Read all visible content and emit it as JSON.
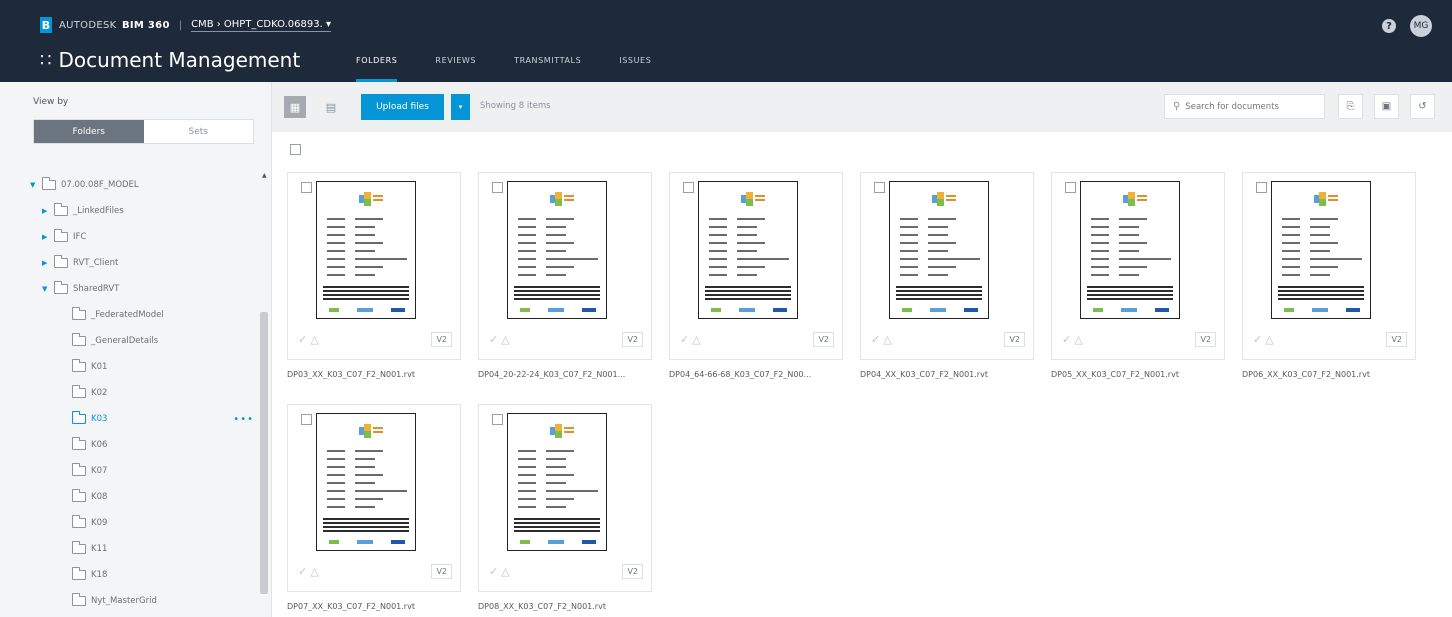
{
  "header": {
    "brand_logo": "B",
    "brand_prefix": "AUTODESK",
    "brand_product": "BIM 360",
    "separator": "|",
    "project": "CMB › OHPT_CDKO.06893. ▾",
    "title": "Document Management",
    "help_label": "?",
    "avatar_initials": "MG",
    "tabs": [
      {
        "label": "FOLDERS",
        "active": true
      },
      {
        "label": "REVIEWS",
        "active": false
      },
      {
        "label": "TRANSMITTALS",
        "active": false
      },
      {
        "label": "ISSUES",
        "active": false
      }
    ]
  },
  "sidebar": {
    "view_by_label": "View by",
    "toggle": {
      "folders": "Folders",
      "sets": "Sets"
    },
    "tree": [
      {
        "label": "07.00.08F_MODEL",
        "depth": 0,
        "caret": "▼",
        "selected": false
      },
      {
        "label": "_LinkedFiles",
        "depth": 1,
        "caret": "▶",
        "selected": false
      },
      {
        "label": "IFC",
        "depth": 1,
        "caret": "▶",
        "selected": false
      },
      {
        "label": "RVT_Client",
        "depth": 1,
        "caret": "▶",
        "selected": false
      },
      {
        "label": "SharedRVT",
        "depth": 1,
        "caret": "▼",
        "selected": false
      },
      {
        "label": "_FederatedModel",
        "depth": 2,
        "caret": "",
        "selected": false
      },
      {
        "label": "_GeneralDetails",
        "depth": 2,
        "caret": "",
        "selected": false
      },
      {
        "label": "K01",
        "depth": 2,
        "caret": "",
        "selected": false
      },
      {
        "label": "K02",
        "depth": 2,
        "caret": "",
        "selected": false
      },
      {
        "label": "K03",
        "depth": 2,
        "caret": "",
        "selected": true
      },
      {
        "label": "K06",
        "depth": 2,
        "caret": "",
        "selected": false
      },
      {
        "label": "K07",
        "depth": 2,
        "caret": "",
        "selected": false
      },
      {
        "label": "K08",
        "depth": 2,
        "caret": "",
        "selected": false
      },
      {
        "label": "K09",
        "depth": 2,
        "caret": "",
        "selected": false
      },
      {
        "label": "K11",
        "depth": 2,
        "caret": "",
        "selected": false
      },
      {
        "label": "K18",
        "depth": 2,
        "caret": "",
        "selected": false
      },
      {
        "label": "Nyt_MasterGrid",
        "depth": 2,
        "caret": "",
        "selected": false
      }
    ],
    "more_label": "•••"
  },
  "toolbar": {
    "upload_label": "Upload files",
    "upload_caret": "▾",
    "showing_label": "Showing 8 items",
    "search_placeholder": "Search for documents"
  },
  "files": [
    {
      "name": "DP03_XX_K03_C07_F2_N001.rvt",
      "version": "V2"
    },
    {
      "name": "DP04_20-22-24_K03_C07_F2_N001...",
      "version": "V2"
    },
    {
      "name": "DP04_64-66-68_K03_C07_F2_N00...",
      "version": "V2"
    },
    {
      "name": "DP04_XX_K03_C07_F2_N001.rvt",
      "version": "V2"
    },
    {
      "name": "DP05_XX_K03_C07_F2_N001.rvt",
      "version": "V2"
    },
    {
      "name": "DP06_XX_K03_C07_F2_N001.rvt",
      "version": "V2"
    },
    {
      "name": "DP07_XX_K03_C07_F2_N001.rvt",
      "version": "V2"
    },
    {
      "name": "DP08_XX_K03_C07_F2_N001.rvt",
      "version": "V2"
    }
  ],
  "colors": {
    "header_bg": "#1e2a3a",
    "accent": "#0696d7",
    "sidebar_bg": "#f4f5f6"
  }
}
